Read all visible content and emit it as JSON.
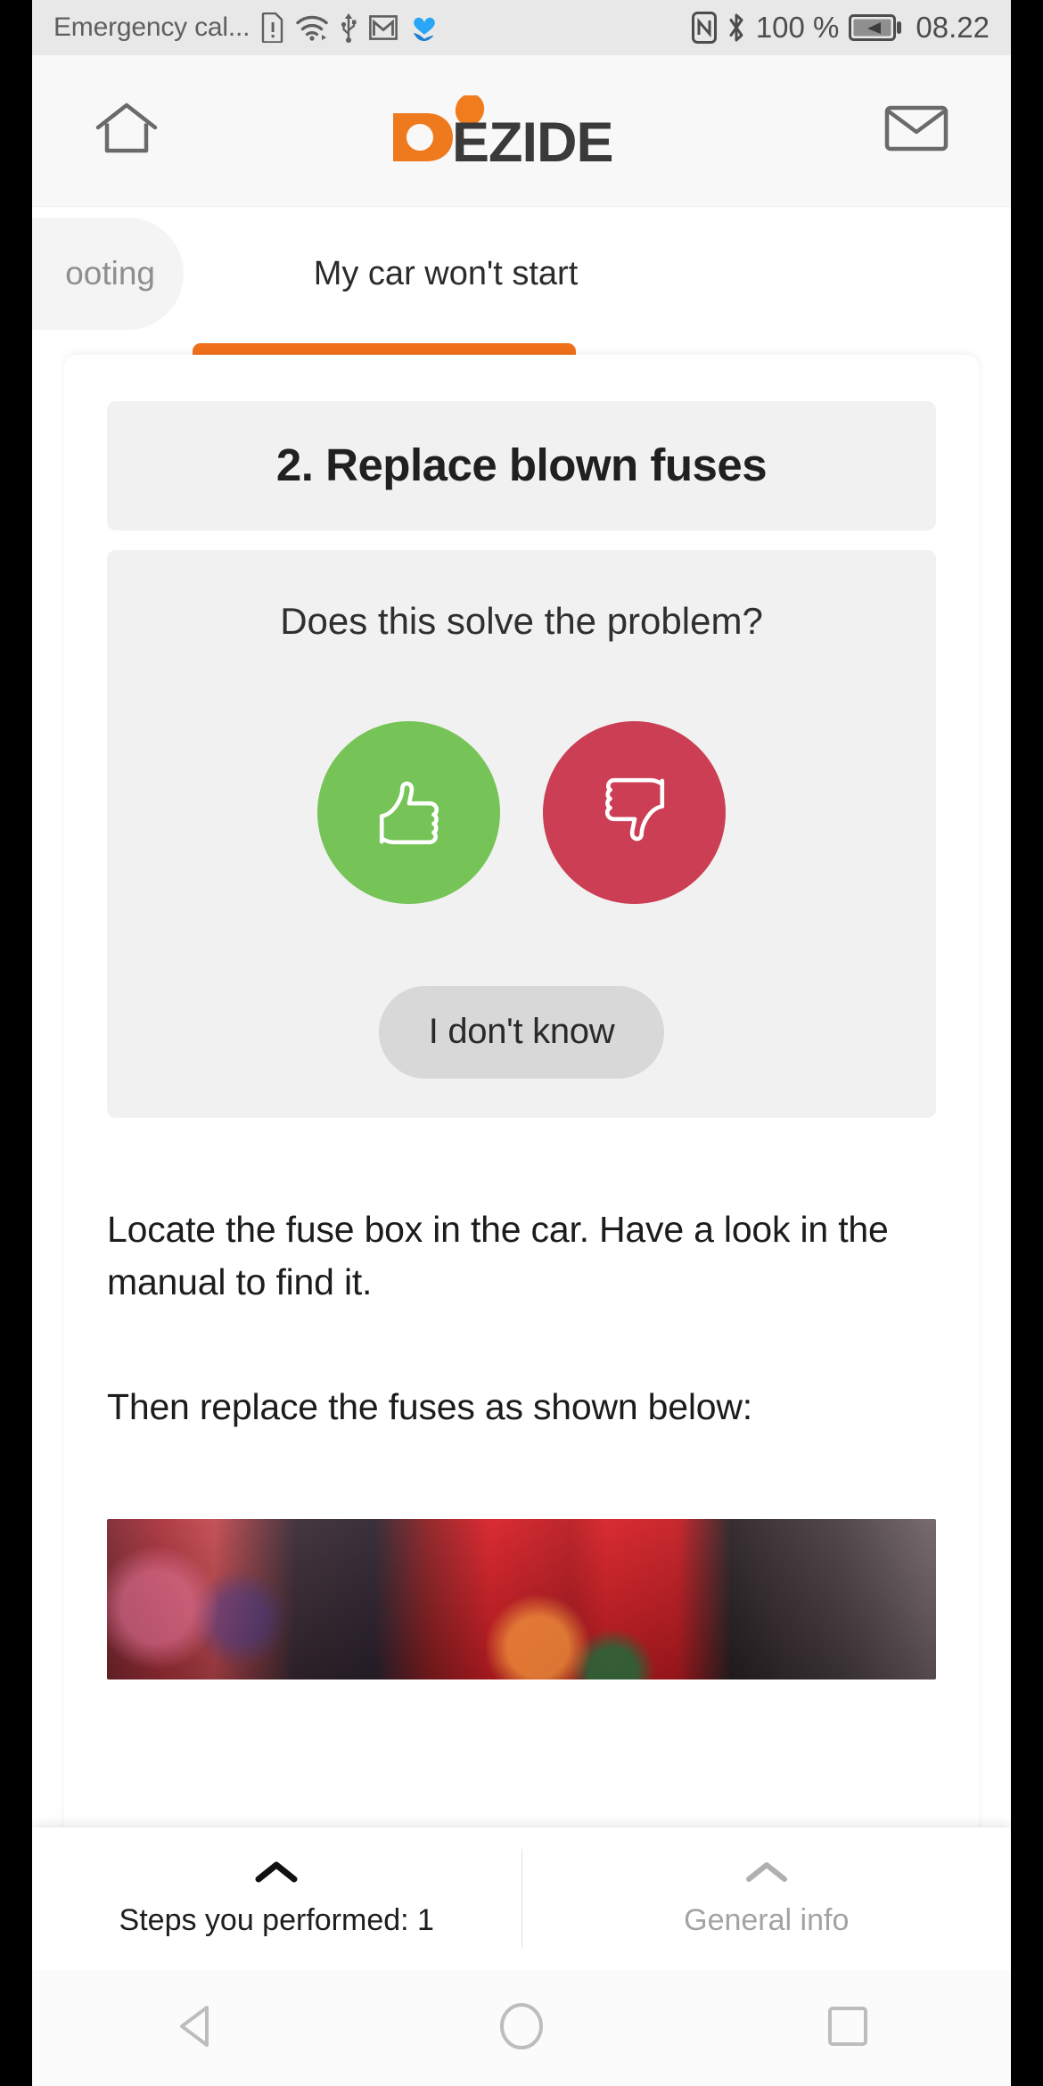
{
  "status_bar": {
    "carrier": "Emergency cal...",
    "battery_percent": "100 %",
    "time": "08.22",
    "icons": [
      "sim-alert-icon",
      "wifi-icon",
      "usb-icon",
      "gmail-icon",
      "blue-heart-icon",
      "nfc-icon",
      "bluetooth-icon",
      "battery-charging-icon"
    ]
  },
  "header": {
    "home_icon": "home-icon",
    "mail_icon": "envelope-icon",
    "logo_text_accent": "D",
    "logo_text_rest": "EZIDE"
  },
  "tabs": {
    "previous": "ooting",
    "active": "My car won't start",
    "accent_color": "#f0701a"
  },
  "main": {
    "step_title": "2. Replace blown fuses",
    "question": "Does this solve the problem?",
    "yes_button": "thumbs-up",
    "no_button": "thumbs-down",
    "yes_color": "#76c457",
    "no_color": "#cc3e53",
    "unknown_button": "I don't know",
    "paragraph_1": "Locate the fuse box in the car. Have a look in the manual to find it.",
    "paragraph_2": "Then replace the fuses as shown below:",
    "photo_alt": "car-fuse-box-photo"
  },
  "bottom_bar": {
    "left_label": "Steps you performed: 1",
    "right_label": "General info",
    "left_chevron": "chevron-up-icon",
    "right_chevron": "chevron-up-icon"
  },
  "nav_bar": {
    "back": "back-triangle-icon",
    "home": "home-circle-icon",
    "recents": "recents-square-icon"
  }
}
